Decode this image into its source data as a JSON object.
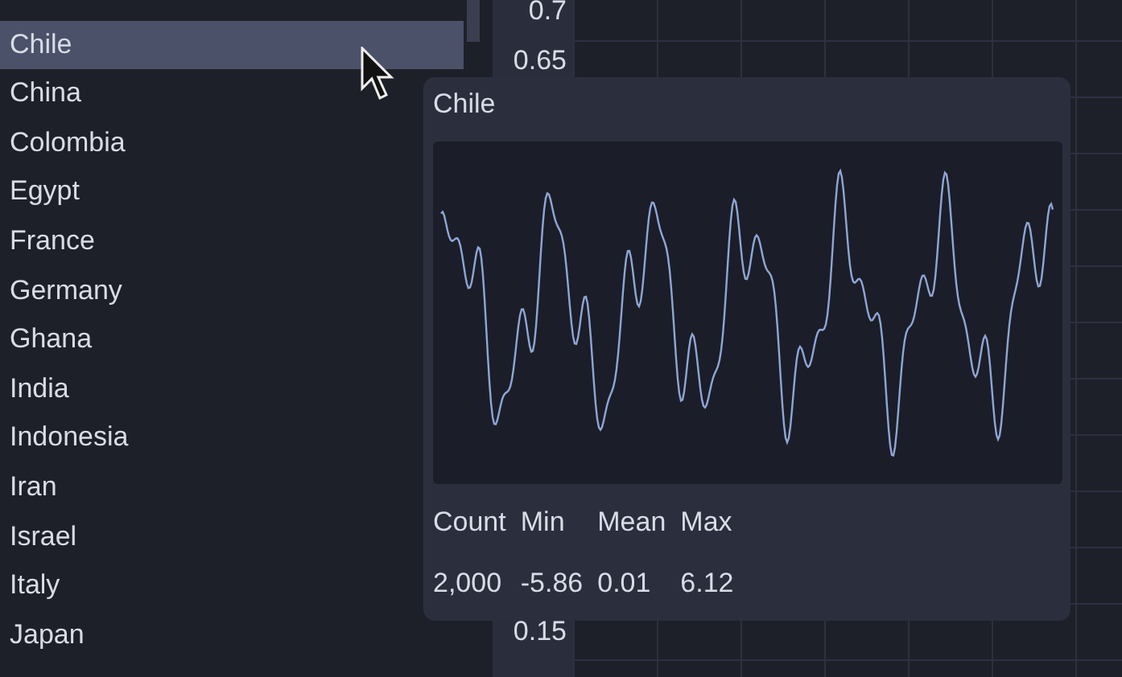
{
  "list": {
    "items": [
      {
        "label": "Chile",
        "selected": true
      },
      {
        "label": "China",
        "selected": false
      },
      {
        "label": "Colombia",
        "selected": false
      },
      {
        "label": "Egypt",
        "selected": false
      },
      {
        "label": "France",
        "selected": false
      },
      {
        "label": "Germany",
        "selected": false
      },
      {
        "label": "Ghana",
        "selected": false
      },
      {
        "label": "India",
        "selected": false
      },
      {
        "label": "Indonesia",
        "selected": false
      },
      {
        "label": "Iran",
        "selected": false
      },
      {
        "label": "Israel",
        "selected": false
      },
      {
        "label": "Italy",
        "selected": false
      },
      {
        "label": "Japan",
        "selected": false
      }
    ]
  },
  "axis": {
    "top_ticks": [
      "0.7",
      "0.65"
    ],
    "bottom_ticks": [
      "0.15"
    ]
  },
  "tooltip": {
    "title": "Chile",
    "stats": [
      {
        "name": "Count",
        "value": "2,000"
      },
      {
        "name": "Min",
        "value": "-5.86"
      },
      {
        "name": "Mean",
        "value": "0.01"
      },
      {
        "name": "Max",
        "value": "6.12"
      }
    ]
  }
}
